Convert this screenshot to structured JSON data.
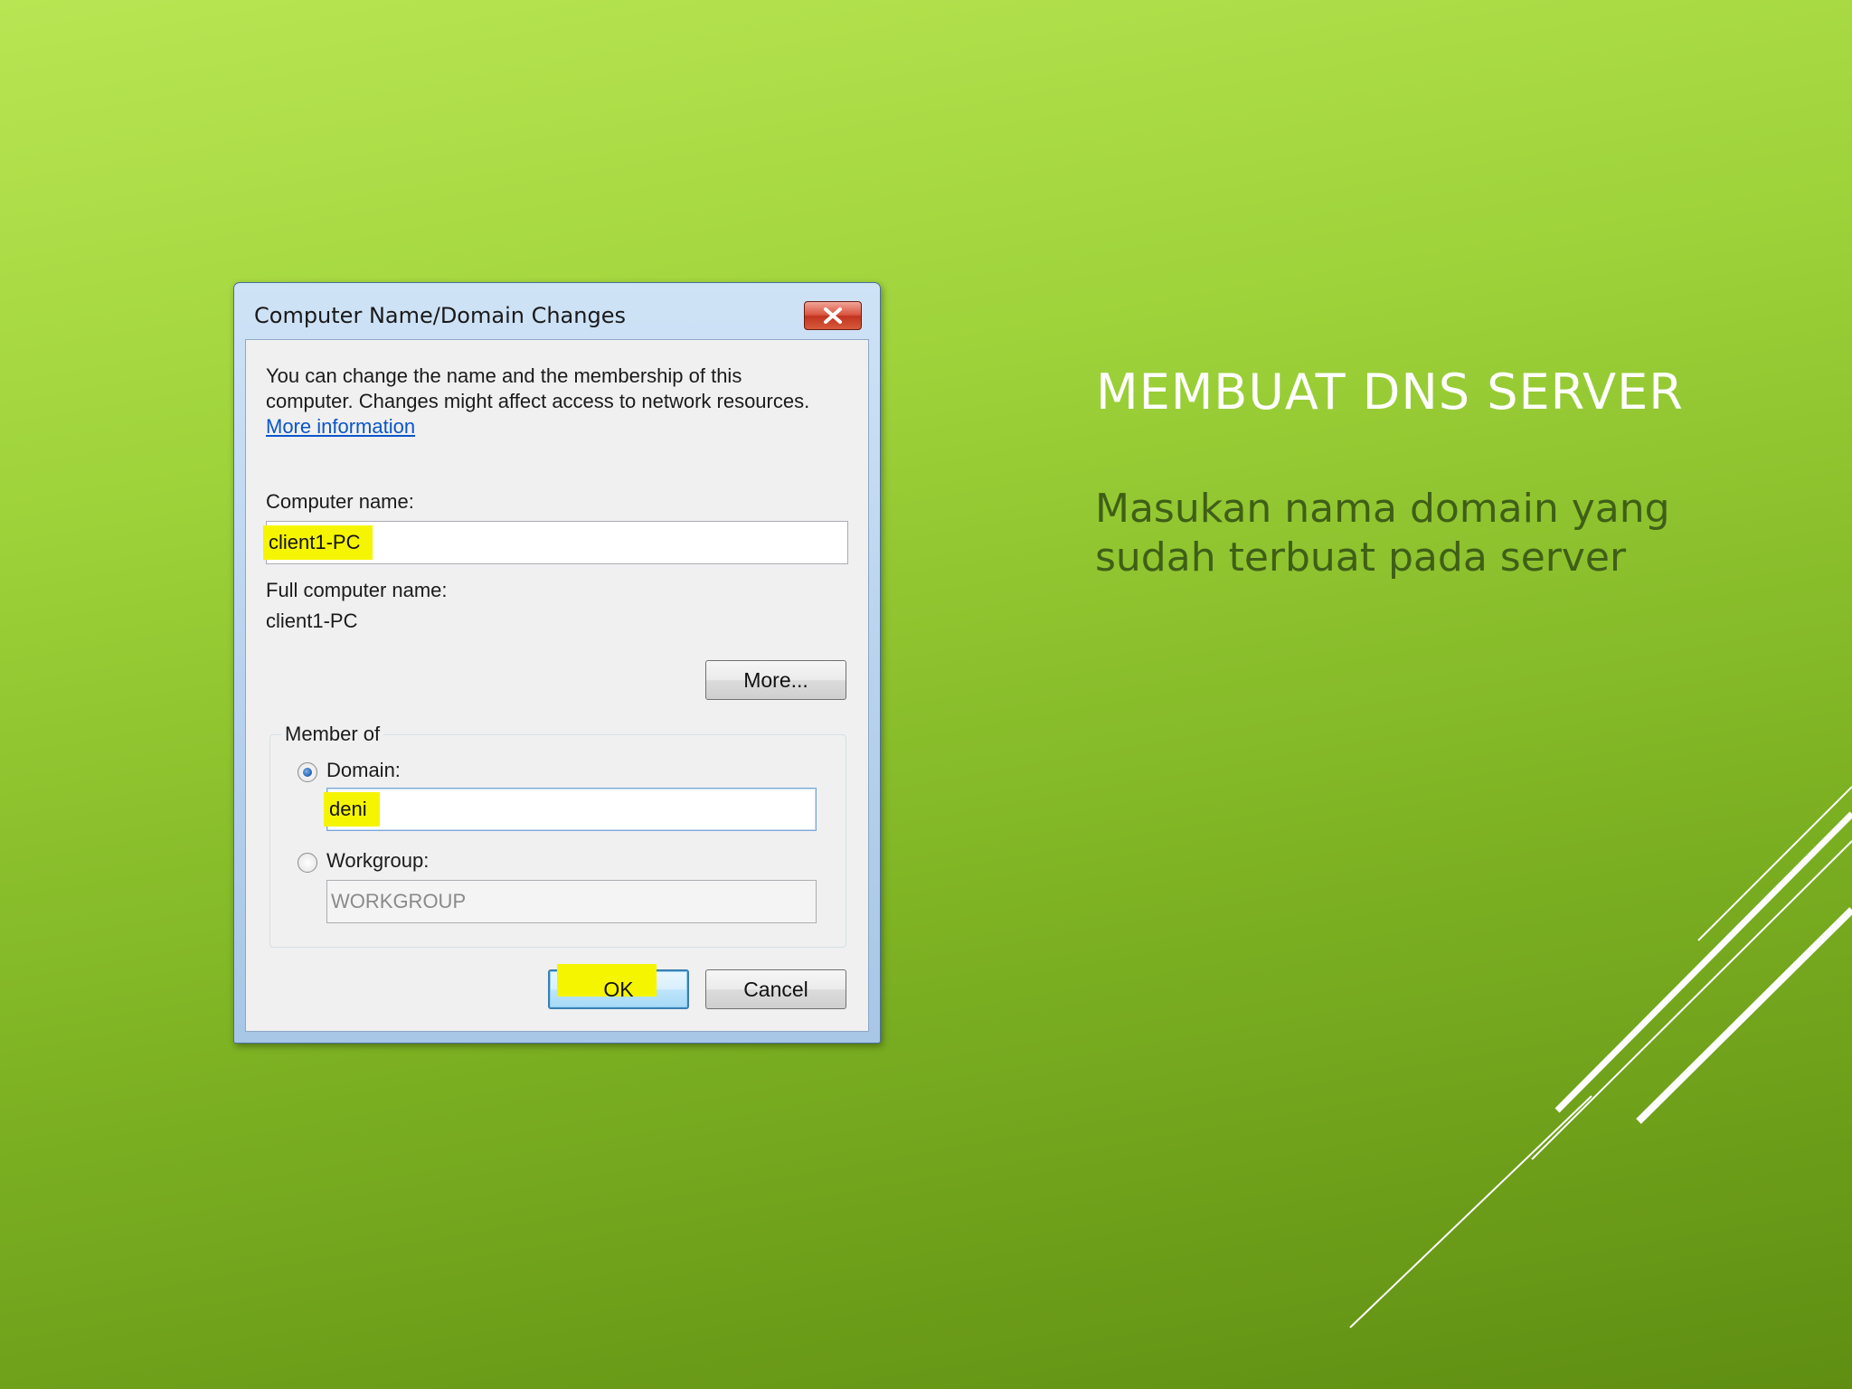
{
  "slide": {
    "title": "MEMBUAT DNS SERVER",
    "body_lines": [
      "Masukan nama domain yang",
      "sudah terbuat pada server"
    ]
  },
  "dialog": {
    "title": "Computer Name/Domain Changes",
    "intro_lines": [
      "You can change the name and the membership of this",
      "computer. Changes might affect access to network resources."
    ],
    "more_info_link": "More information",
    "computer_name_label": "Computer name:",
    "computer_name_value": "client1-PC",
    "full_name_label": "Full computer name:",
    "full_name_value": "client1-PC",
    "more_button": "More...",
    "member_of_label": "Member of",
    "domain_label": "Domain:",
    "domain_value": "deni",
    "domain_selected": true,
    "workgroup_label": "Workgroup:",
    "workgroup_value": "WORKGROUP",
    "ok_button": "OK",
    "cancel_button": "Cancel"
  },
  "colors": {
    "highlight": "#f6f500",
    "link": "#0a56c8",
    "slide_title": "#ffffff",
    "slide_body": "#3f5f17"
  }
}
